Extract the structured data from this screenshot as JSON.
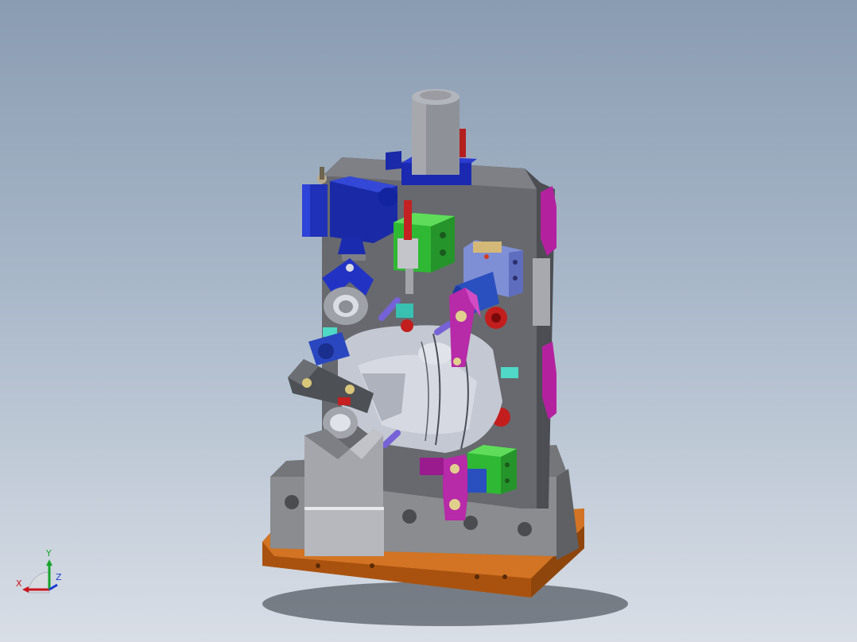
{
  "viewport": {
    "background_top": "#8a9cb2",
    "background_bottom": "#d9dee6"
  },
  "model": {
    "name_icon": "welding-fixture-assembly-icon",
    "colors": {
      "base_plate": "#c8681c",
      "steel_gray": "#7d7f84",
      "plate_gray": "#8c8e92",
      "clamp_blue": "#2233b8",
      "clamp_magenta": "#b3219e",
      "block_green": "#38c63c",
      "part_light": "#c8ccd6",
      "cylinder_gray": "#9a9ca4",
      "stop_red": "#c41818",
      "pin_cyan": "#4fd9c6"
    }
  },
  "triad": {
    "x_label": "X",
    "y_label": "Y",
    "z_label": "Z",
    "x_color": "#c8141e",
    "y_color": "#17a32c",
    "z_color": "#1c3dcf"
  }
}
